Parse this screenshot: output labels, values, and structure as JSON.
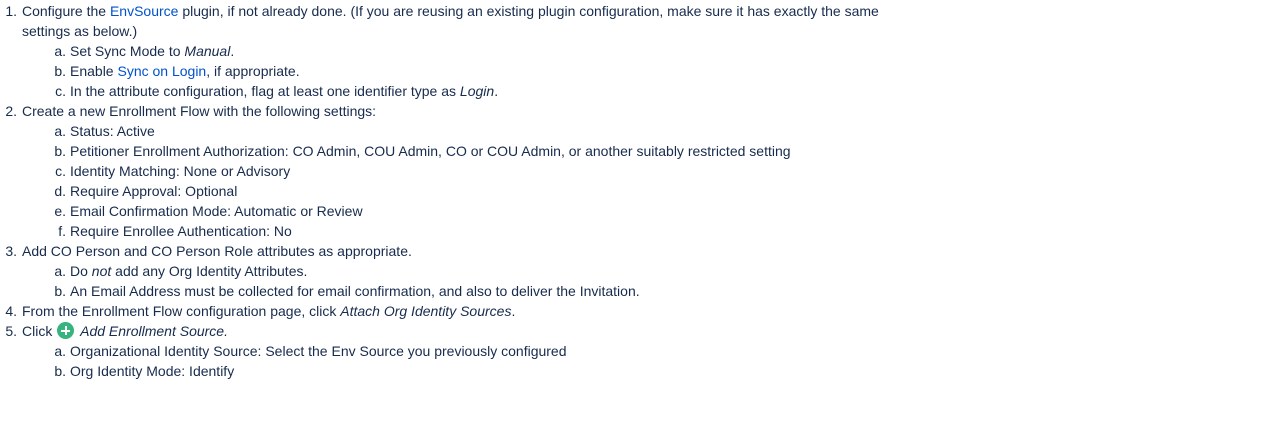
{
  "steps": [
    {
      "num": "1.",
      "pre": "Configure the ",
      "link": "EnvSource",
      "post": " plugin, if not already done. (If you are reusing an existing plugin configuration, make sure it has exactly the same",
      "cont": "settings as below.)",
      "sub": [
        {
          "num": "a.",
          "pre": "Set Sync Mode to ",
          "em": "Manual",
          "post": "."
        },
        {
          "num": "b.",
          "pre": "Enable ",
          "link": "Sync on Login",
          "post": ", if appropriate."
        },
        {
          "num": "c.",
          "pre": "In the attribute configuration, flag at least one identifier type as ",
          "em": "Login",
          "post": "."
        }
      ]
    },
    {
      "num": "2.",
      "text": "Create a new Enrollment Flow with the following settings:",
      "sub": [
        {
          "num": "a.",
          "text": "Status: Active"
        },
        {
          "num": "b.",
          "text": "Petitioner Enrollment Authorization: CO Admin, COU Admin, CO or COU Admin, or another suitably restricted setting"
        },
        {
          "num": "c.",
          "text": "Identity Matching: None or Advisory"
        },
        {
          "num": "d.",
          "text": "Require Approval: Optional"
        },
        {
          "num": "e.",
          "text": "Email Confirmation Mode: Automatic or Review"
        },
        {
          "num": "f.",
          "text": "Require Enrollee Authentication: No"
        }
      ]
    },
    {
      "num": "3.",
      "text": "Add CO Person and CO Person Role attributes as appropriate.",
      "sub": [
        {
          "num": "a.",
          "pre": "Do ",
          "em": "not",
          "post": " add any Org Identity Attributes."
        },
        {
          "num": "b.",
          "text": "An Email Address must be collected for email confirmation, and also to deliver the Invitation."
        }
      ]
    },
    {
      "num": "4.",
      "pre": "From the Enrollment Flow configuration page, click ",
      "em": "Attach Org Identity Sources",
      "post": "."
    },
    {
      "num": "5.",
      "pre": "Click ",
      "icon": "plus-circle-icon",
      "em": "Add Enrollment Source.",
      "sub": [
        {
          "num": "a.",
          "text": "Organizational Identity Source: Select the Env Source you previously configured"
        },
        {
          "num": "b.",
          "text": "Org Identity Mode: Identify"
        }
      ]
    }
  ]
}
